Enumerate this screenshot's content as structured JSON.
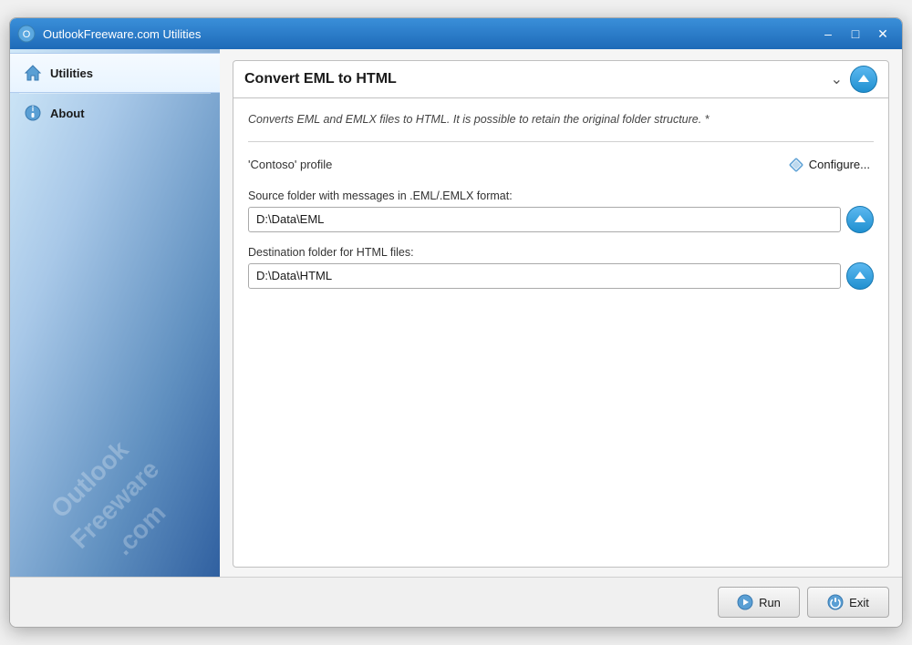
{
  "window": {
    "title": "OutlookFreeware.com Utilities"
  },
  "titlebar": {
    "title": "OutlookFreeware.com Utilities",
    "minimize_label": "–",
    "maximize_label": "□",
    "close_label": "✕"
  },
  "sidebar": {
    "watermark_line1": "Outlook Freeware .com",
    "items": [
      {
        "id": "utilities",
        "label": "Utilities",
        "icon": "house-icon",
        "active": true
      },
      {
        "id": "about",
        "label": "About",
        "icon": "info-icon",
        "active": false
      }
    ]
  },
  "converter": {
    "title": "Convert EML to HTML",
    "description": "Converts EML and EMLX files to HTML. It is possible to retain the original folder structure. *",
    "profile_label": "'Contoso' profile",
    "configure_label": "Configure...",
    "source_folder_label": "Source folder with messages in .EML/.EMLX format:",
    "source_folder_value": "D:\\Data\\EML",
    "destination_folder_label": "Destination folder for HTML files:",
    "destination_folder_value": "D:\\Data\\HTML"
  },
  "buttons": {
    "run_label": "Run",
    "exit_label": "Exit"
  },
  "icons": {
    "chevron_down": "⌄",
    "upload": "▲",
    "configure_diamond": "◇",
    "run_play": "▶",
    "exit_power": "⏻"
  }
}
